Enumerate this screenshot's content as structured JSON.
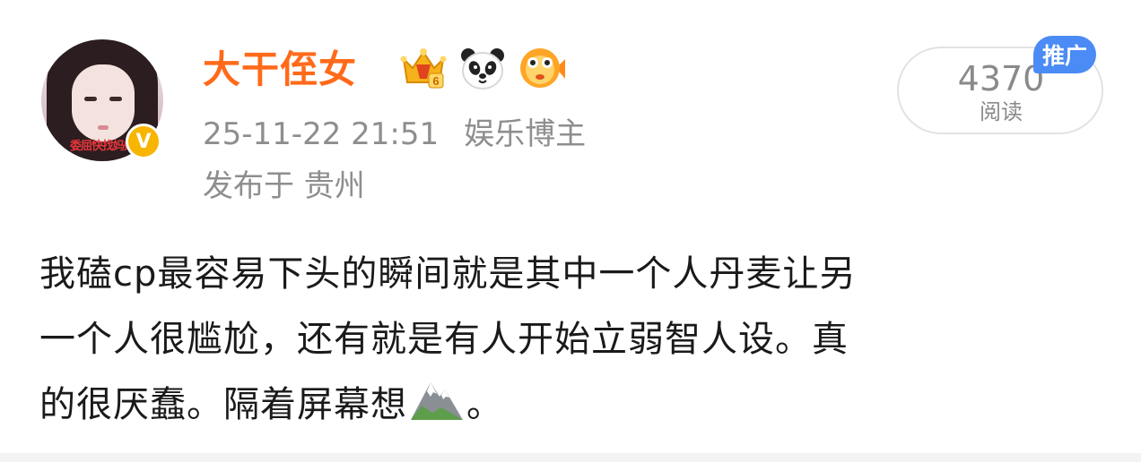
{
  "author": {
    "name": "大干侄女",
    "avatar_caption": "委屈快找妈妈",
    "badges": [
      "crown-level-6-icon",
      "panda-icon",
      "pufferfish-icon"
    ],
    "verified_icon": "verified-v-icon",
    "verified_letter": "V"
  },
  "meta": {
    "datetime": "25-11-22 21:51",
    "category": "娱乐博主",
    "location": "发布于 贵州"
  },
  "reads": {
    "count": "4370",
    "label": "阅读",
    "promo_tag": "推广"
  },
  "post": {
    "line1": "我磕cp最容易下头的瞬间就是其中一个人丹麦让另",
    "line2": "一个人很尴尬，还有就是有人开始立弱智人设。真",
    "line3a": "的很厌蠢。隔着屏幕想",
    "emoji": "mountain-emoji",
    "line3b": "。"
  },
  "colors": {
    "username": "#ff6a1a",
    "meta_text": "#8e8e8e",
    "promo_bg": "#4a8bf5",
    "verified": "#f7b500"
  }
}
